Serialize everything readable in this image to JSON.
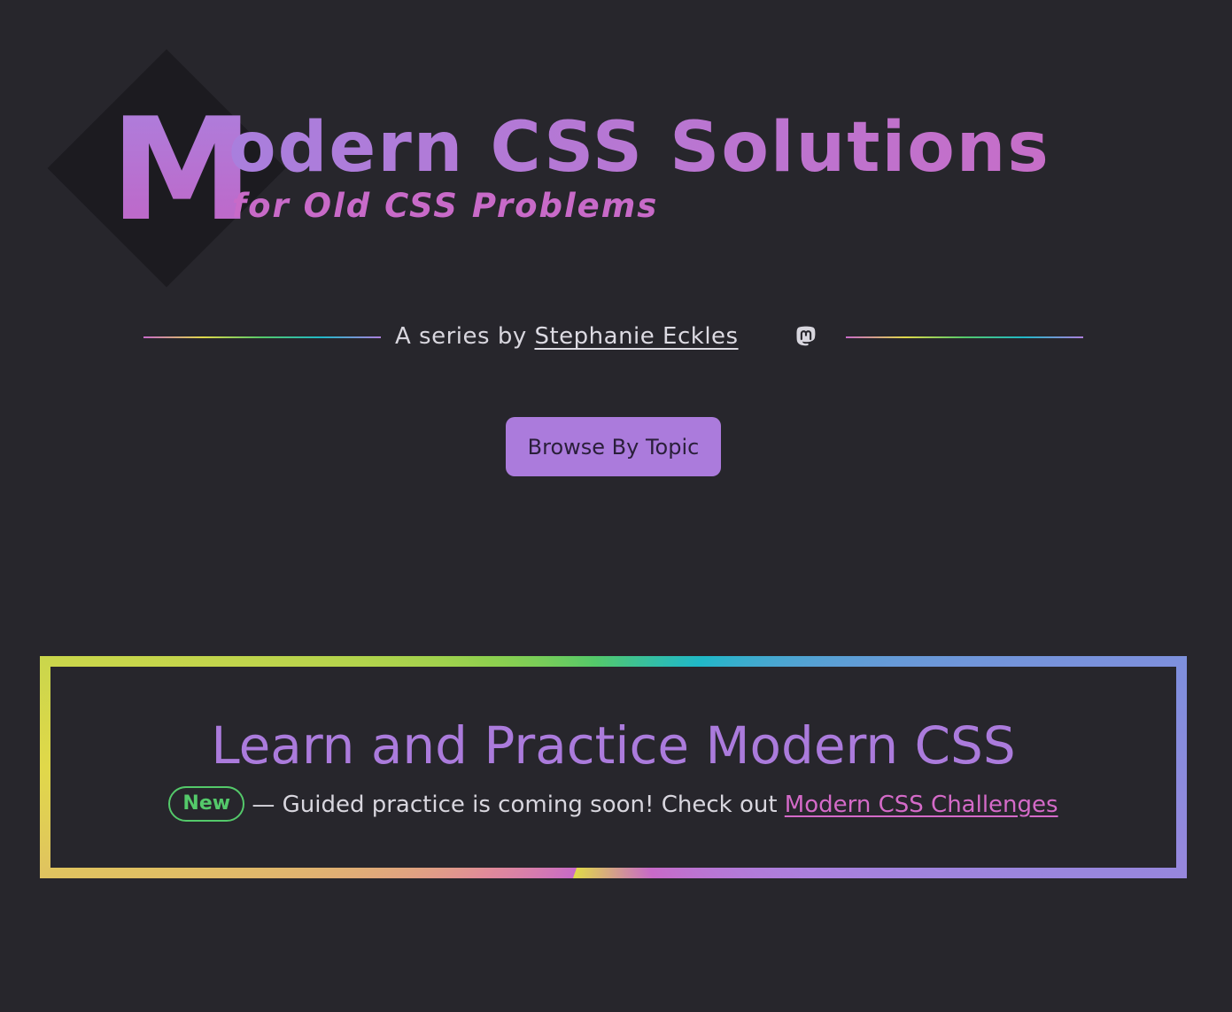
{
  "header": {
    "logo_letter": "M",
    "title_rest": "odern CSS Solutions",
    "subtitle": "for Old CSS Problems"
  },
  "byline": {
    "prefix": "A series by ",
    "author": "Stephanie Eckles",
    "social_icon": "mastodon-icon"
  },
  "nav": {
    "browse_label": "Browse By Topic"
  },
  "promo": {
    "title": "Learn and Practice Modern CSS",
    "badge": "New",
    "text": " — Guided practice is coming soon! Check out ",
    "link_label": "Modern CSS Challenges"
  },
  "colors": {
    "background": "#27262c",
    "accent_purple": "#ab7bdc",
    "accent_pink": "#c86ac8",
    "badge_green": "#54c96a",
    "link_pink": "#d46ac8"
  }
}
